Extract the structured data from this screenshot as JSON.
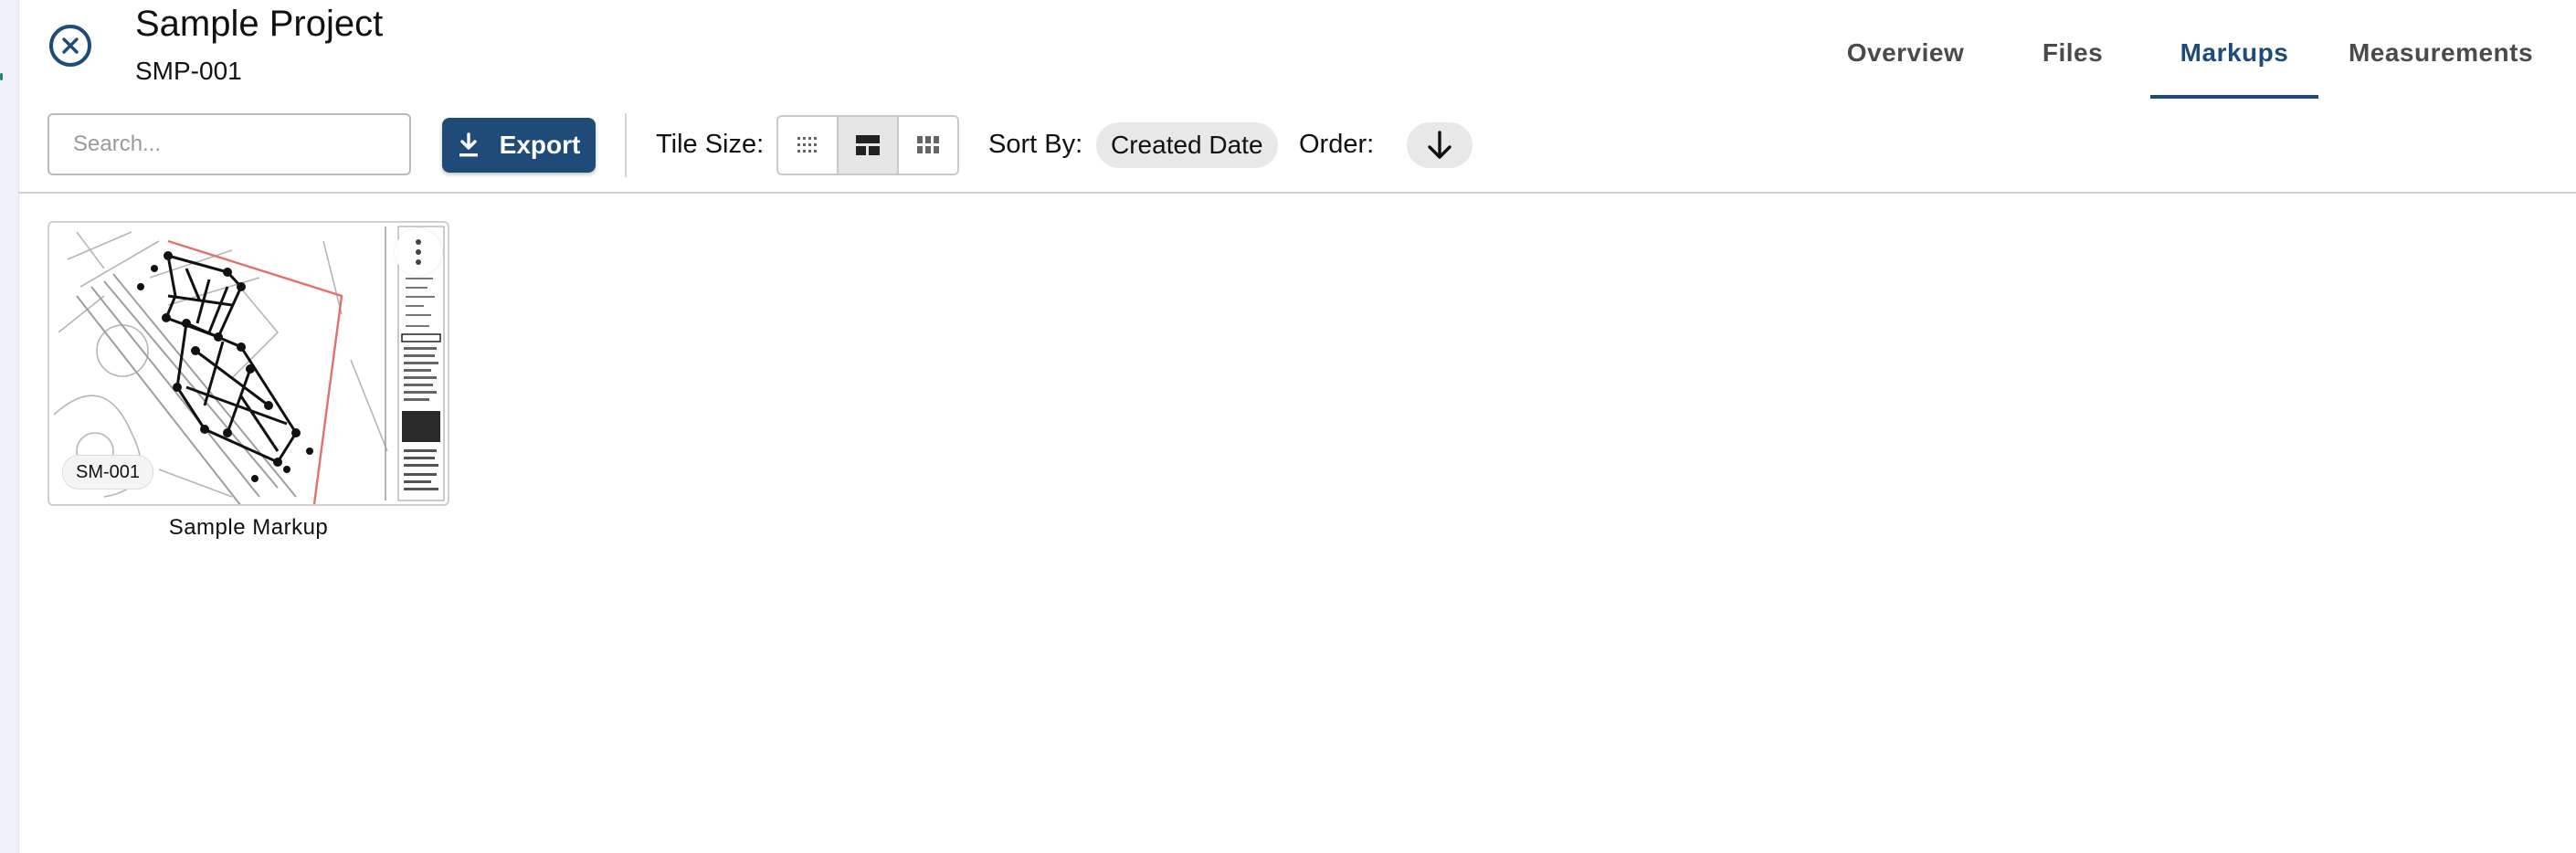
{
  "project": {
    "title": "Sample Project",
    "code": "SMP-001"
  },
  "tabs": [
    {
      "label": "Overview"
    },
    {
      "label": "Files"
    },
    {
      "label": "Markups",
      "active": true
    },
    {
      "label": "Measurements"
    }
  ],
  "toolbar": {
    "search_placeholder": "Search...",
    "search_value": "",
    "export_label": "Export",
    "tile_size_label": "Tile Size:",
    "tile_size_selected": "medium",
    "sort_by_label": "Sort By:",
    "sort_by_value": "Created Date",
    "order_label": "Order:",
    "order_direction": "descending",
    "order_icon": "arrow-down-icon"
  },
  "markups": [
    {
      "title": "Sample Markup",
      "sheet": "SM-001",
      "menu_icon": "more-vertical-icon"
    }
  ],
  "colors": {
    "accent": "#1f4b79",
    "chip": "#e8e8e8",
    "divider": "#cfcfcf"
  }
}
